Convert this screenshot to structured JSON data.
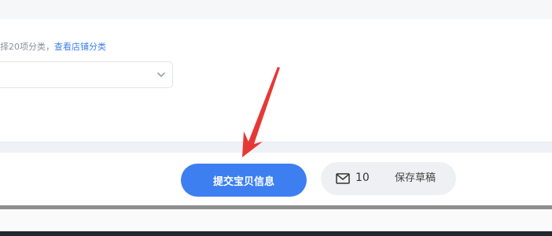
{
  "form": {
    "category_hint": "择20项分类，",
    "view_store_categories": "查看店铺分类",
    "category_select_value": ""
  },
  "actions": {
    "submit_label": "提交宝贝信息",
    "message_count": "10",
    "save_draft_label": "保存草稿"
  },
  "icons": {
    "select_chevron": "chevron-down-icon",
    "message": "mail-icon"
  },
  "annotation": {
    "arrow_color": "#e53935"
  },
  "colors": {
    "primary": "#3d7ff1",
    "link": "#3d7fe8",
    "draft_bg": "#eff0f3"
  }
}
